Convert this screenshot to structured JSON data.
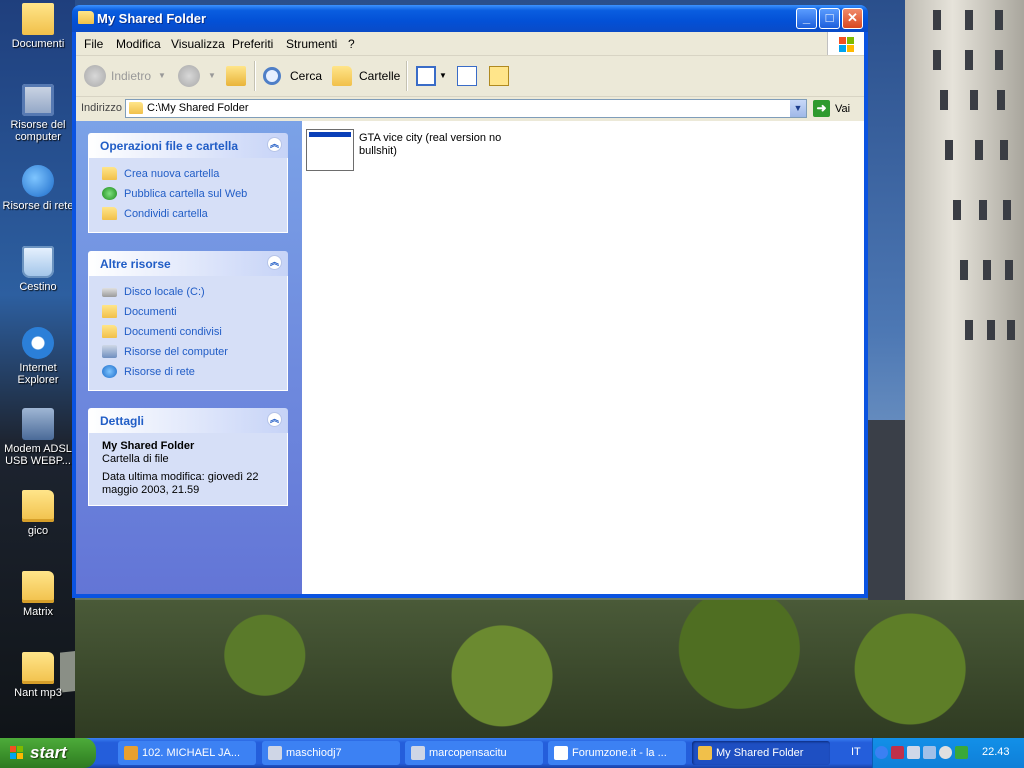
{
  "desktop": {
    "icons": [
      {
        "label": "Documenti",
        "icon": "folder-icon"
      },
      {
        "label": "Risorse del computer",
        "icon": "computer-icon"
      },
      {
        "label": "Risorse di rete",
        "icon": "network-icon"
      },
      {
        "label": "Cestino",
        "icon": "recycle-bin-icon"
      },
      {
        "label": "Internet Explorer",
        "icon": "ie-icon"
      },
      {
        "label": "Modem ADSL USB WEBP...",
        "icon": "modem-icon"
      },
      {
        "label": "gico",
        "icon": "folder-icon"
      },
      {
        "label": "Matrix",
        "icon": "folder-icon"
      },
      {
        "label": "Nant mp3",
        "icon": "folder-icon"
      }
    ]
  },
  "window": {
    "title": "My Shared Folder",
    "menu": [
      "File",
      "Modifica",
      "Visualizza",
      "Preferiti",
      "Strumenti",
      "?"
    ],
    "toolbar": {
      "back": "Indietro",
      "search": "Cerca",
      "folders": "Cartelle"
    },
    "address": {
      "label": "Indirizzo",
      "value": "C:\\My Shared Folder",
      "go": "Vai"
    },
    "taskpane": {
      "file_ops": {
        "title": "Operazioni file e cartella",
        "items": [
          "Crea nuova cartella",
          "Pubblica cartella sul Web",
          "Condividi cartella"
        ]
      },
      "other": {
        "title": "Altre risorse",
        "items": [
          "Disco locale (C:)",
          "Documenti",
          "Documenti condivisi",
          "Risorse del computer",
          "Risorse di rete"
        ]
      },
      "details": {
        "title": "Dettagli",
        "name": "My Shared Folder",
        "type": "Cartella di file",
        "modified": "Data ultima modifica: giovedì 22 maggio 2003, 21.59"
      }
    },
    "files": [
      {
        "name": "GTA vice city (real version no bullshit)"
      }
    ]
  },
  "taskbar": {
    "start": "start",
    "tasks": [
      {
        "label": "102. MICHAEL JA...",
        "color": "#e8a030"
      },
      {
        "label": "maschiodj7",
        "color": "#cfd6e6"
      },
      {
        "label": "marcopensacitu",
        "color": "#cfd6e6"
      },
      {
        "label": "Forumzone.it - la ...",
        "color": "#ffffff"
      },
      {
        "label": "My Shared Folder",
        "color": "#f1c04a"
      }
    ],
    "lang": "IT",
    "clock": "22.43"
  }
}
